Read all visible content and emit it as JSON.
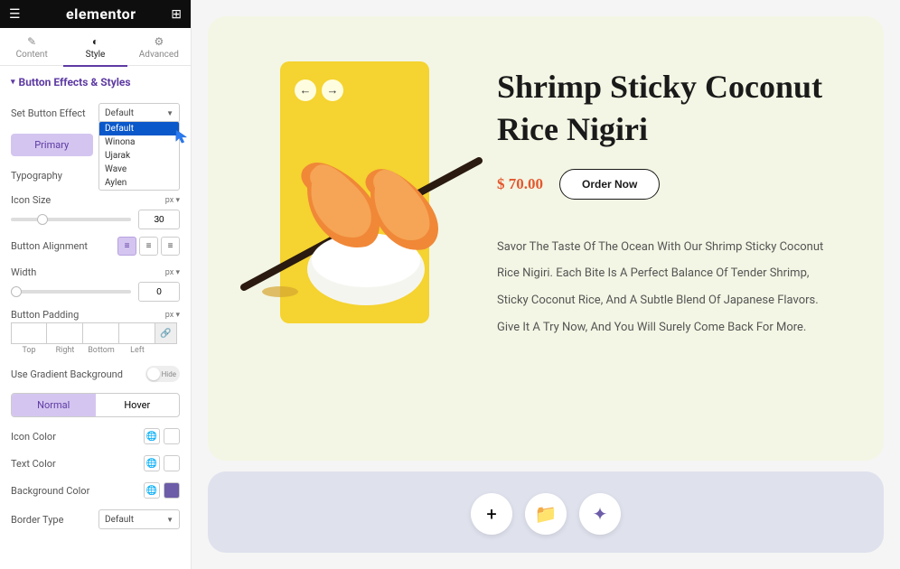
{
  "header": {
    "logo": "elementor"
  },
  "tabs": {
    "content": "Content",
    "style": "Style",
    "advanced": "Advanced"
  },
  "section": {
    "title": "Button Effects & Styles"
  },
  "effect": {
    "label": "Set Button Effect",
    "value": "Default",
    "options": [
      "Default",
      "Winona",
      "Ujarak",
      "Wave",
      "Aylen"
    ]
  },
  "buttons": {
    "primary": "Primary",
    "secondary": ""
  },
  "typography": {
    "label": "Typography"
  },
  "iconSize": {
    "label": "Icon Size",
    "unit": "px",
    "value": "30"
  },
  "alignment": {
    "label": "Button Alignment"
  },
  "width": {
    "label": "Width",
    "unit": "px",
    "value": "0"
  },
  "padding": {
    "label": "Button Padding",
    "unit": "px",
    "sides": {
      "top": "Top",
      "right": "Right",
      "bottom": "Bottom",
      "left": "Left"
    }
  },
  "gradient": {
    "label": "Use Gradient Background",
    "hide": "Hide"
  },
  "state": {
    "normal": "Normal",
    "hover": "Hover"
  },
  "iconColor": {
    "label": "Icon Color"
  },
  "textColor": {
    "label": "Text Color"
  },
  "bgColor": {
    "label": "Background Color",
    "swatch": "#6d5ca8"
  },
  "borderType": {
    "label": "Border Type",
    "value": "Default"
  },
  "canvas": {
    "title": "Shrimp Sticky Coconut Rice Nigiri",
    "price": "$ 70.00",
    "orderBtn": "Order Now",
    "description": "Savor The Taste Of The Ocean With Our Shrimp Sticky Coconut Rice Nigiri. Each Bite Is A Perfect Balance Of Tender Shrimp, Sticky Coconut Rice, And A Subtle Blend Of Japanese Flavors. Give It A Try Now, And You Will Surely Come Back For More."
  }
}
